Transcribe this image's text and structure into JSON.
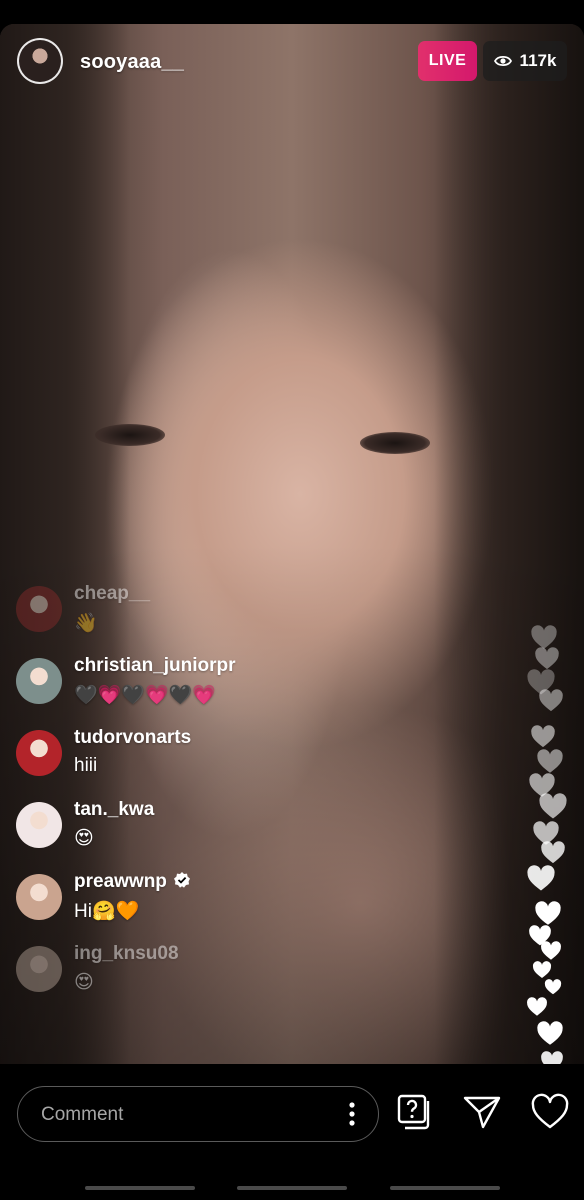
{
  "host": {
    "username": "sooyaaa__"
  },
  "live_label": "LIVE",
  "viewer_count": "117k",
  "comments": [
    {
      "user": "cheap__",
      "text": "👋",
      "faded": true,
      "avatar_color": "#8a2b2b"
    },
    {
      "user": "christian_juniorpr",
      "text": "🖤💗🖤💗🖤💗",
      "faded": false,
      "avatar_color": "#7d8f8c"
    },
    {
      "user": "tudorvonarts",
      "text": "hiii",
      "faded": false,
      "avatar_color": "#b3242a"
    },
    {
      "user": "tan._kwa",
      "text": "😍",
      "faded": false,
      "avatar_color": "#f1e6e6"
    },
    {
      "user": "preawwnp",
      "text": "Hi🤗🧡",
      "faded": false,
      "verified": true,
      "avatar_color": "#caa48f"
    },
    {
      "user": "ing_knsu08",
      "text": "😍",
      "faded": true,
      "avatar_color": "#b9a79a"
    }
  ],
  "comment_input": {
    "placeholder": "Comment"
  },
  "colors": {
    "live": "#e1306c",
    "background": "#000000"
  },
  "icons": [
    "eye-icon",
    "more-options-icon",
    "question-sticker-icon",
    "send-icon",
    "like-heart-icon"
  ]
}
